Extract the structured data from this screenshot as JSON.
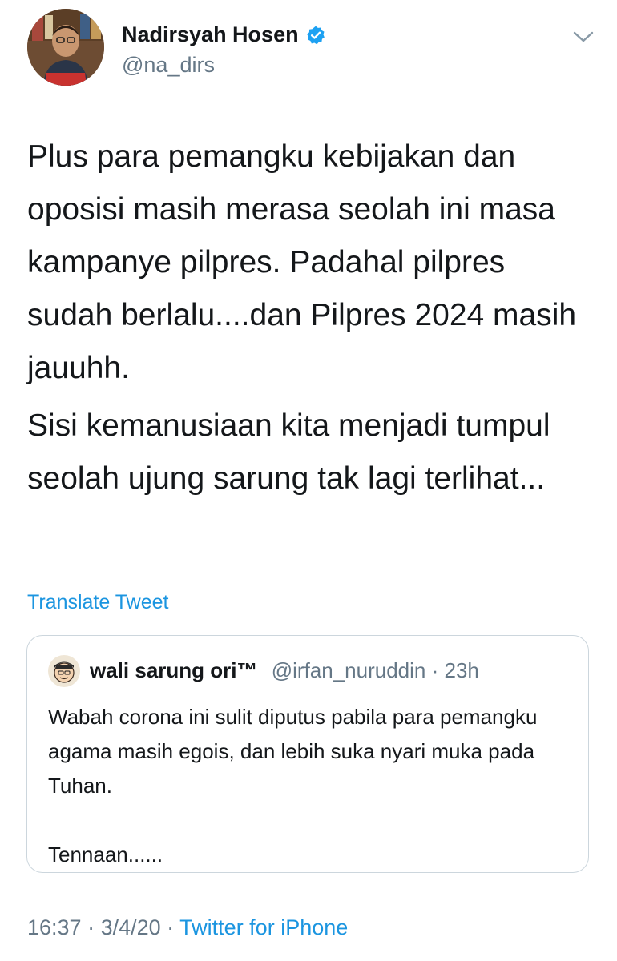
{
  "tweet": {
    "author": {
      "name": "Nadirsyah Hosen",
      "handle": "@na_dirs",
      "verified": true
    },
    "text": {
      "paragraph_1": "Plus para pemangku kebijakan dan oposisi masih merasa seolah ini masa kampanye pilpres. Padahal pilpres sudah berlalu....dan Pilpres 2024 masih jauuhh.",
      "paragraph_2": "Sisi kemanusiaan kita menjadi tumpul seolah ujung sarung tak lagi terlihat..."
    },
    "translate_label": "Translate Tweet",
    "meta": {
      "time": "16:37",
      "separator": " · ",
      "date": "3/4/20",
      "source": "Twitter for iPhone"
    }
  },
  "quoted_tweet": {
    "name": "wali sarung ori™",
    "handle": "@irfan_nuruddin",
    "separator": "·",
    "time": "23h",
    "text_line_1": "Wabah corona ini sulit diputus pabila para pemangku agama masih egois, dan lebih suka nyari muka pada Tuhan.",
    "text_line_2": "Tennaan......"
  },
  "icons": {
    "avatar": "author-avatar",
    "verified": "verified-badge-icon",
    "menu": "chevron-down-icon",
    "quoted_avatar": "quoted-author-avatar"
  },
  "colors": {
    "link": "#1b95e0",
    "secondary_text": "#657786",
    "primary_text": "#14171a",
    "verified": "#1da1f2",
    "card_border": "#ccd6dd"
  }
}
